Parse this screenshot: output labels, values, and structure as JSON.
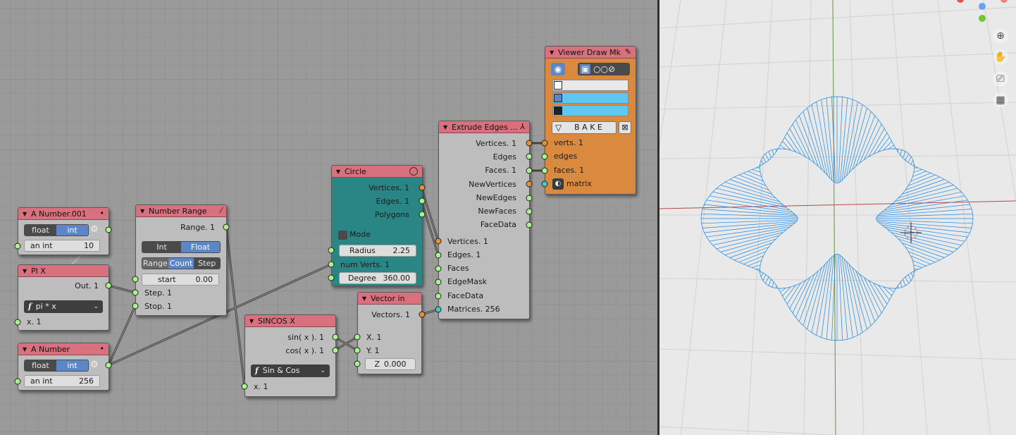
{
  "nodes": {
    "a_number_001": {
      "title": "A Number.001",
      "mode_float": "float",
      "mode_int": "int",
      "label": "an int",
      "value": "10"
    },
    "pi_x": {
      "title": "PI X",
      "out": "Out. 1",
      "func": "pi * x",
      "input": "x. 1"
    },
    "a_number": {
      "title": "A Number",
      "mode_float": "float",
      "mode_int": "int",
      "label": "an int",
      "value": "256"
    },
    "number_range": {
      "title": "Number Range",
      "output": "Range. 1",
      "type_int": "Int",
      "type_float": "Float",
      "mode_range": "Range",
      "mode_count": "Count",
      "mode_step": "Step",
      "start_label": "start",
      "start_value": "0.00",
      "in_step": "Step. 1",
      "in_stop": "Stop. 1"
    },
    "circle": {
      "title": "Circle",
      "out_vertices": "Vertices. 1",
      "out_edges": "Edges. 1",
      "out_polygons": "Polygons",
      "mode": "Mode",
      "radius_label": "Radius",
      "radius_value": "2.25",
      "numverts": "num Verts. 1",
      "degree_label": "Degree",
      "degree_value": "360.00"
    },
    "sincos": {
      "title": "SINCOS X",
      "out_sin": "sin( x ). 1",
      "out_cos": "cos( x ). 1",
      "func": "Sin & Cos",
      "input": "x. 1"
    },
    "vector_in": {
      "title": "Vector in",
      "out": "Vectors. 1",
      "in_x": "X. 1",
      "in_y": "Y. 1",
      "z_label": "Z",
      "z_value": "0.000"
    },
    "extrude": {
      "title": "Extrude Edges ...",
      "out_vertices": "Vertices. 1",
      "out_edges": "Edges",
      "out_faces": "Faces. 1",
      "out_newvertices": "NewVertices",
      "out_newedges": "NewEdges",
      "out_newfaces": "NewFaces",
      "out_facedata": "FaceData",
      "in_vertices": "Vertices. 1",
      "in_edges": "Edges. 1",
      "in_faces": "Faces",
      "in_edgemask": "EdgeMask",
      "in_facedata": "FaceData",
      "in_matrices": "Matrices. 256"
    },
    "viewer": {
      "title": "Viewer Draw Mk",
      "bake": "B A K E",
      "in_verts": "verts. 1",
      "in_edges": "edges",
      "in_faces": "faces. 1",
      "in_matrix": "matrix"
    }
  },
  "icons": {
    "node_collapse": "triangle-down-icon",
    "settings": "gear-icon",
    "pencil": "pencil-icon",
    "eye": "eye-icon",
    "zoom": "zoom-icon",
    "hand": "hand-icon",
    "camera": "camera-icon",
    "grid": "grid-icon"
  },
  "colors": {
    "header": "#d9707e",
    "circle_body": "#2a8585",
    "viewer_body": "#d98a3e",
    "mesh": "#1a88e8",
    "socket_green": "#a8f28f",
    "socket_orange": "#e8902f",
    "socket_cyan": "#44c8c8",
    "toggle_on": "#5c86c8"
  }
}
